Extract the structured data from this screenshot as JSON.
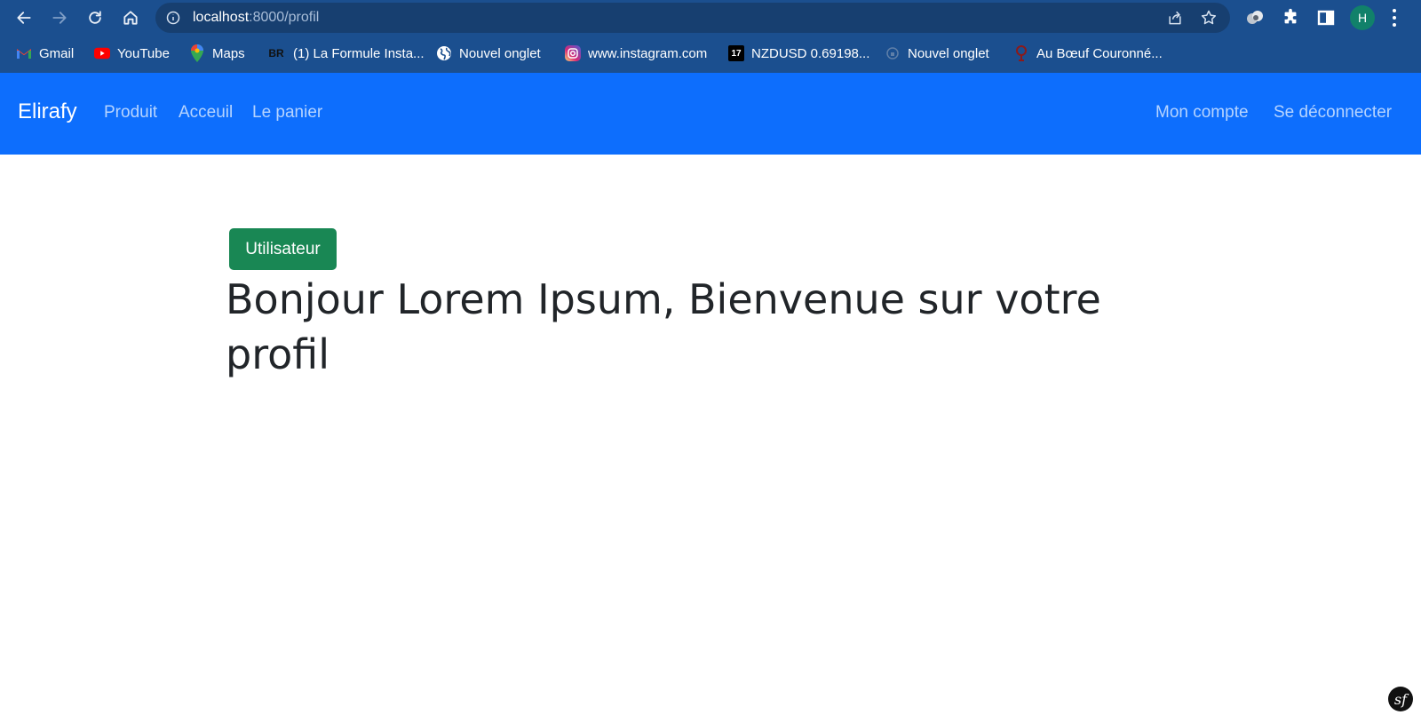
{
  "browser": {
    "url_host": "localhost",
    "url_rest": ":8000/profil",
    "avatar_initial": "H",
    "bookmarks": [
      {
        "label": "Gmail",
        "icon": "gmail-icon"
      },
      {
        "label": "YouTube",
        "icon": "youtube-icon"
      },
      {
        "label": "Maps",
        "icon": "maps-icon"
      },
      {
        "label": "(1) La Formule Insta...",
        "icon": "br-icon",
        "icon_text": "BR"
      },
      {
        "label": "Nouvel onglet",
        "icon": "globe-icon"
      },
      {
        "label": "www.instagram.com",
        "icon": "instagram-icon"
      },
      {
        "label": "NZDUSD 0.69198...",
        "icon": "tradingview-icon",
        "icon_text": "17"
      },
      {
        "label": "Nouvel onglet",
        "icon": "page-icon"
      },
      {
        "label": "Au Bœuf Couronné...",
        "icon": "crown-icon"
      }
    ]
  },
  "navbar": {
    "brand": "Elirafy",
    "links": [
      "Produit",
      "Acceuil",
      "Le panier"
    ],
    "right_links": [
      "Mon compte",
      "Se déconnecter"
    ],
    "color": "#0d6efd"
  },
  "main": {
    "badge": "Utilisateur",
    "badge_color": "#198754",
    "heading": "Bonjour Lorem Ipsum, Bienvenue sur votre profil"
  },
  "footer": {
    "symfony_logo_text": "sf"
  }
}
